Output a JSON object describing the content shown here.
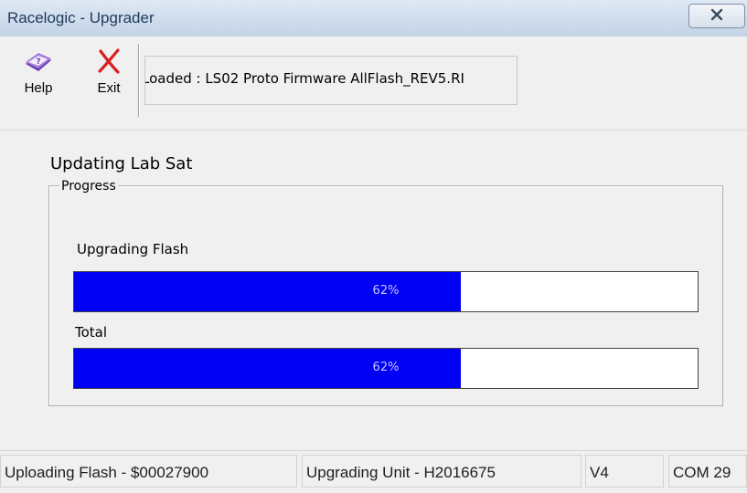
{
  "window": {
    "title": "Racelogic - Upgrader",
    "close_label": "X"
  },
  "toolbar": {
    "help_label": "Help",
    "exit_label": "Exit",
    "help_icon": "help-book-icon",
    "exit_icon": "red-x-icon",
    "loaded_text": "Loaded : LS02 Proto Firmware AllFlash_REV5.RI"
  },
  "main": {
    "heading": "Updating Lab Sat",
    "group_label": "Progress",
    "bars": [
      {
        "label": "Upgrading Flash",
        "percent_text": "62%",
        "percent": 62
      },
      {
        "label": "Total",
        "percent_text": "62%",
        "percent": 62
      }
    ]
  },
  "statusbar": {
    "panels": [
      "Uploading Flash - $00027900",
      "Upgrading Unit - H2016675",
      "V4",
      "COM 29"
    ]
  },
  "colors": {
    "progress_fill": "#0000f5",
    "exit_icon": "#d81e1e",
    "help_icon": "#8a5cc8"
  }
}
